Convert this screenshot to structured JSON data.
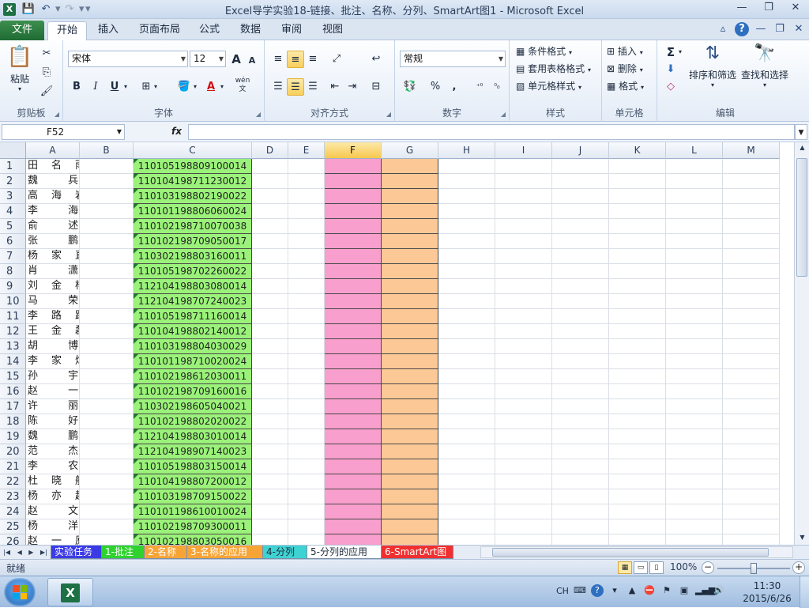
{
  "window": {
    "title": "Excel导学实验18-链接、批注、名称、分列、SmartArt图1  -  Microsoft Excel",
    "controls": [
      "—",
      "❐",
      "✕"
    ],
    "ribbon_controls": [
      "▵",
      "?",
      "—",
      "❐",
      "✕"
    ]
  },
  "qat": {
    "save": "💾",
    "undo": "↶",
    "redo": "↷"
  },
  "tabs": [
    "文件",
    "开始",
    "插入",
    "页面布局",
    "公式",
    "数据",
    "审阅",
    "视图"
  ],
  "ribbon": {
    "clipboard": {
      "paste": "粘贴",
      "label": "剪贴板"
    },
    "font": {
      "name": "宋体",
      "size": "12",
      "label": "字体",
      "bold": "B",
      "italic": "I",
      "underline": "U",
      "grow": "A",
      "shrink": "A",
      "wen": "wén\n文"
    },
    "alignment": {
      "label": "对齐方式"
    },
    "number": {
      "format": "常规",
      "label": "数字",
      "percent": "%",
      "comma": ","
    },
    "styles": {
      "cond": "条件格式",
      "table": "套用表格格式",
      "cell": "单元格样式",
      "label": "样式"
    },
    "cells": {
      "insert": "插入",
      "delete": "删除",
      "format": "格式",
      "label": "单元格"
    },
    "editing": {
      "sum": "Σ",
      "sort": "排序和筛选",
      "find": "查找和选择",
      "label": "编辑"
    }
  },
  "formula_bar": {
    "name_box": "F52",
    "fx": "fx",
    "value": ""
  },
  "columns": [
    "A",
    "B",
    "C",
    "D",
    "E",
    "F",
    "G",
    "H",
    "I",
    "J",
    "K",
    "L",
    "M"
  ],
  "selected_column": "F",
  "rows": [
    {
      "n": "1",
      "a": "田名雨",
      "c": "110105198809100014"
    },
    {
      "n": "2",
      "a": "魏  兵",
      "c": "110104198711230012"
    },
    {
      "n": "3",
      "a": "高海岩",
      "c": "110103198802190022"
    },
    {
      "n": "4",
      "a": "李  海",
      "c": "110101198806060024"
    },
    {
      "n": "5",
      "a": "俞  述",
      "c": "110102198710070038"
    },
    {
      "n": "6",
      "a": "张  鹏",
      "c": "110102198709050017"
    },
    {
      "n": "7",
      "a": "杨家直",
      "c": "110302198803160011"
    },
    {
      "n": "8",
      "a": "肖  潇",
      "c": "110105198702260022"
    },
    {
      "n": "9",
      "a": "刘金杨",
      "c": "112104198803080014"
    },
    {
      "n": "10",
      "a": "马  荣",
      "c": "112104198707240023"
    },
    {
      "n": "11",
      "a": "李路路",
      "c": "110105198711160014"
    },
    {
      "n": "12",
      "a": "王金磊",
      "c": "110104198802140012"
    },
    {
      "n": "13",
      "a": "胡  博",
      "c": "110103198804030029"
    },
    {
      "n": "14",
      "a": "李家烨",
      "c": "110101198710020024"
    },
    {
      "n": "15",
      "a": "孙  宇",
      "c": "110102198612030011"
    },
    {
      "n": "16",
      "a": "赵  一",
      "c": "110102198709160016"
    },
    {
      "n": "17",
      "a": "许  丽",
      "c": "110302198605040021"
    },
    {
      "n": "18",
      "a": "陈  好",
      "c": "110102198802020022"
    },
    {
      "n": "19",
      "a": "魏  鹏",
      "c": "112104198803010014"
    },
    {
      "n": "20",
      "a": "范  杰",
      "c": "112104198907140023"
    },
    {
      "n": "21",
      "a": "李  农",
      "c": "110105198803150014"
    },
    {
      "n": "22",
      "a": "杜晓航",
      "c": "110104198807200012"
    },
    {
      "n": "23",
      "a": "杨亦超",
      "c": "110103198709150022"
    },
    {
      "n": "24",
      "a": "赵  文",
      "c": "110101198610010024"
    },
    {
      "n": "25",
      "a": "杨  洋",
      "c": "110102198709300011"
    },
    {
      "n": "26",
      "a": "赵一原",
      "c": "110102198803050016"
    }
  ],
  "sheet_tabs": [
    {
      "label": "实验任务",
      "bg": "#3b3be6",
      "color": "#ffffff"
    },
    {
      "label": "1-批注",
      "bg": "#2fd22f",
      "color": "#ffffff"
    },
    {
      "label": "2-名称",
      "bg": "#f7a437",
      "color": "#ffffff"
    },
    {
      "label": "3-名称的应用",
      "bg": "#f7a437",
      "color": "#ffffff"
    },
    {
      "label": "4-分列",
      "bg": "#3fd2d2",
      "color": "#1e2b3e"
    },
    {
      "label": "5-分列的应用",
      "bg": "#ffffff",
      "color": "#1e2b3e"
    },
    {
      "label": "6-SmartArt图",
      "bg": "#f03030",
      "color": "#ffffff"
    }
  ],
  "status": {
    "ready": "就绪",
    "zoom": "100%",
    "zoom_level": 1.0
  },
  "taskbar": {
    "lang": "CH",
    "time": "11:30",
    "date": "2015/6/26"
  },
  "colors": {
    "c_fill": "#9bf27a",
    "f_fill": "#f99fcd",
    "g_fill": "#fcc896",
    "file_tab": "#2a7a3e",
    "selected_header": "#f7c74e"
  }
}
